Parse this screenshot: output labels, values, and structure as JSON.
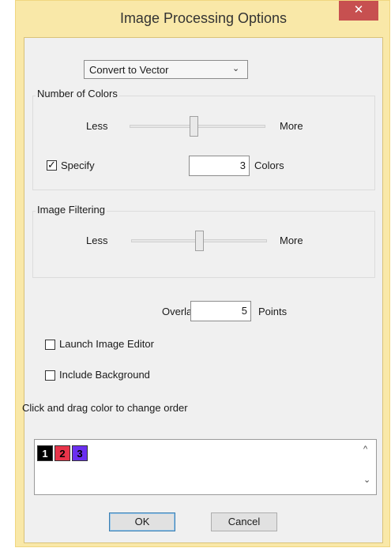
{
  "window": {
    "title": "Image Processing Options",
    "close_glyph": "✕"
  },
  "conversion": {
    "selected": "Convert to Vector",
    "chevron": "⌄"
  },
  "number_of_colors": {
    "label": "Number of Colors",
    "less": "Less",
    "more": "More",
    "slider_fraction": 0.47,
    "specify_label": "Specify",
    "specify_checked": true,
    "colors_value": "3",
    "colors_unit": "Colors"
  },
  "image_filtering": {
    "label": "Image Filtering",
    "less": "Less",
    "more": "More",
    "slider_fraction": 0.5
  },
  "overlap": {
    "label": "Overlap:",
    "value": "5",
    "unit": "Points"
  },
  "launch_image_editor": {
    "label": "Launch Image Editor",
    "checked": false
  },
  "include_background": {
    "label": "Include Background",
    "checked": false
  },
  "order_hint": "Click and drag color to change order",
  "color_order": [
    {
      "label": "1",
      "color": "#000000",
      "text_color": "#ffffff"
    },
    {
      "label": "2",
      "color": "#e8344a",
      "text_color": "#000000"
    },
    {
      "label": "3",
      "color": "#6a2ff0",
      "text_color": "#000000"
    }
  ],
  "scroll": {
    "up": "^",
    "down": "⌄"
  },
  "buttons": {
    "ok": "OK",
    "cancel": "Cancel"
  },
  "colors": {
    "title_bar": "#f9e8a8",
    "close_button": "#c75050",
    "dialog_bg": "#f0f0f0"
  }
}
